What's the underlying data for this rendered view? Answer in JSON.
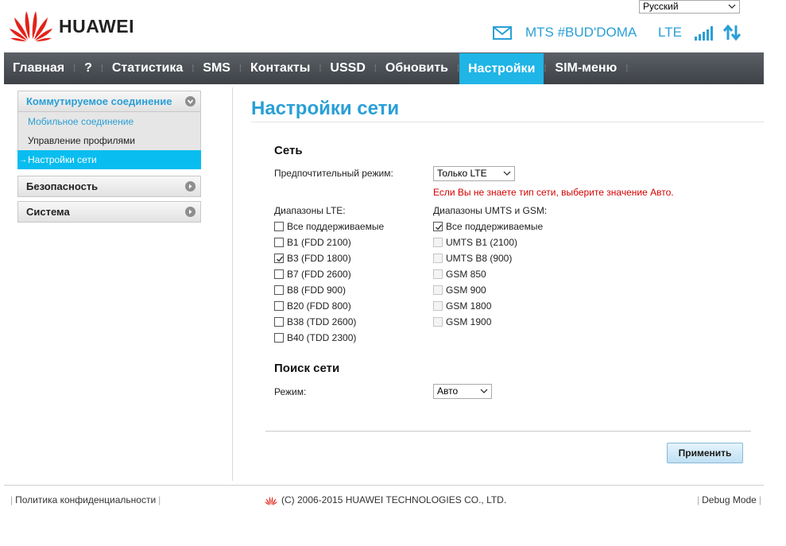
{
  "header": {
    "language": "Русский",
    "logo_text": "HUAWEI",
    "operator": "MTS #BUD'DOMA",
    "network_type": "LTE"
  },
  "nav": {
    "items": [
      {
        "label": "Главная"
      },
      {
        "label": "?"
      },
      {
        "label": "Статистика"
      },
      {
        "label": "SMS"
      },
      {
        "label": "Контакты"
      },
      {
        "label": "USSD"
      },
      {
        "label": "Обновить"
      },
      {
        "label": "Настройки",
        "active": true
      },
      {
        "label": "SIM-меню"
      }
    ]
  },
  "sidebar": {
    "dialup": {
      "label": "Коммутируемое соединение",
      "items": [
        {
          "label": "Мобильное соединение"
        },
        {
          "label": "Управление профилями"
        },
        {
          "label": "Настройки сети",
          "active": true
        }
      ]
    },
    "security": {
      "label": "Безопасность"
    },
    "system": {
      "label": "Система"
    }
  },
  "main": {
    "title": "Настройки сети",
    "network": {
      "title": "Сеть",
      "preferred_mode_label": "Предпочтительный режим:",
      "preferred_mode_value": "Только LTE",
      "warning": "Если Вы не знаете тип сети, выберите значение Авто.",
      "lte_label": "Диапазоны LTE:",
      "lte_bands": [
        {
          "label": "Все поддерживаемые",
          "checked": false
        },
        {
          "label": "B1 (FDD 2100)",
          "checked": false
        },
        {
          "label": "B3 (FDD 1800)",
          "checked": true
        },
        {
          "label": "B7 (FDD 2600)",
          "checked": false
        },
        {
          "label": "B8 (FDD 900)",
          "checked": false
        },
        {
          "label": "B20 (FDD 800)",
          "checked": false
        },
        {
          "label": "B38 (TDD 2600)",
          "checked": false
        },
        {
          "label": "B40 (TDD 2300)",
          "checked": false
        }
      ],
      "umts_label": "Диапазоны UMTS и GSM:",
      "umts_bands": [
        {
          "label": "Все поддерживаемые",
          "checked": true,
          "disabled": false
        },
        {
          "label": "UMTS B1 (2100)",
          "checked": false,
          "disabled": true
        },
        {
          "label": "UMTS B8 (900)",
          "checked": false,
          "disabled": true
        },
        {
          "label": "GSM 850",
          "checked": false,
          "disabled": true
        },
        {
          "label": "GSM 900",
          "checked": false,
          "disabled": true
        },
        {
          "label": "GSM 1800",
          "checked": false,
          "disabled": true
        },
        {
          "label": "GSM 1900",
          "checked": false,
          "disabled": true
        }
      ]
    },
    "search": {
      "title": "Поиск сети",
      "mode_label": "Режим:",
      "mode_value": "Авто"
    },
    "apply_label": "Применить"
  },
  "footer": {
    "privacy": "Политика конфиденциальности",
    "copyright": "(C) 2006-2015 HUAWEI TECHNOLOGIES CO., LTD.",
    "debug": "Debug Mode"
  },
  "colors": {
    "accent": "#2a9fd6",
    "nav_active": "#1fb5e6",
    "warning": "#d40000",
    "brand_red": "#e2231a"
  },
  "icons": [
    "huawei-logo",
    "mail-icon",
    "signal-icon",
    "transfer-icon",
    "chevron-down-icon",
    "circle-arrow-icon",
    "check-icon"
  ]
}
